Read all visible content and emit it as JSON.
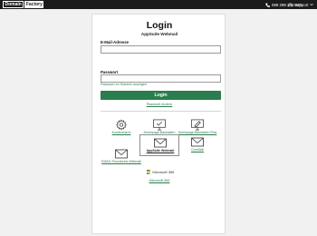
{
  "topbar": {
    "logo_part1": "Domain",
    "logo_part2": "Factory",
    "phone_icon": "phone-icon",
    "phone": "069 299 280 020",
    "support_icon": "headset-icon",
    "support": "Support",
    "support_chevron_icon": "chevron-down-icon"
  },
  "login": {
    "title": "Login",
    "subtitle": "AppSuite Webmail",
    "email_label": "E-Mail-Adresse",
    "email_value": "",
    "password_label": "Passwort",
    "password_value": "",
    "show_password": "Passwort im Klartext anzeigen",
    "button": "Login",
    "forgot": "Passwort ändern"
  },
  "apps": [
    {
      "label": "Kundenmenü",
      "icon": "gear-icon"
    },
    {
      "label": "Homepage-Baukasten",
      "icon": "monitor-check-icon"
    },
    {
      "label": "Homepage-Baukasten Plus",
      "icon": "monitor-pen-icon"
    },
    {
      "label": "EMAIL Roundcube Webmail",
      "icon": "envelope-icon"
    },
    {
      "label": "AppSuite Webmail",
      "icon": "envelope-icon"
    },
    {
      "label": "CoreMail",
      "icon": "envelope-icon"
    }
  ],
  "microsoft": {
    "logo_text": "Microsoft 365",
    "link": "Microsoft 365"
  },
  "colors": {
    "accent": "#2a7d4c",
    "topbar": "#1b1b1b",
    "page_bg": "#f1f1f1"
  }
}
